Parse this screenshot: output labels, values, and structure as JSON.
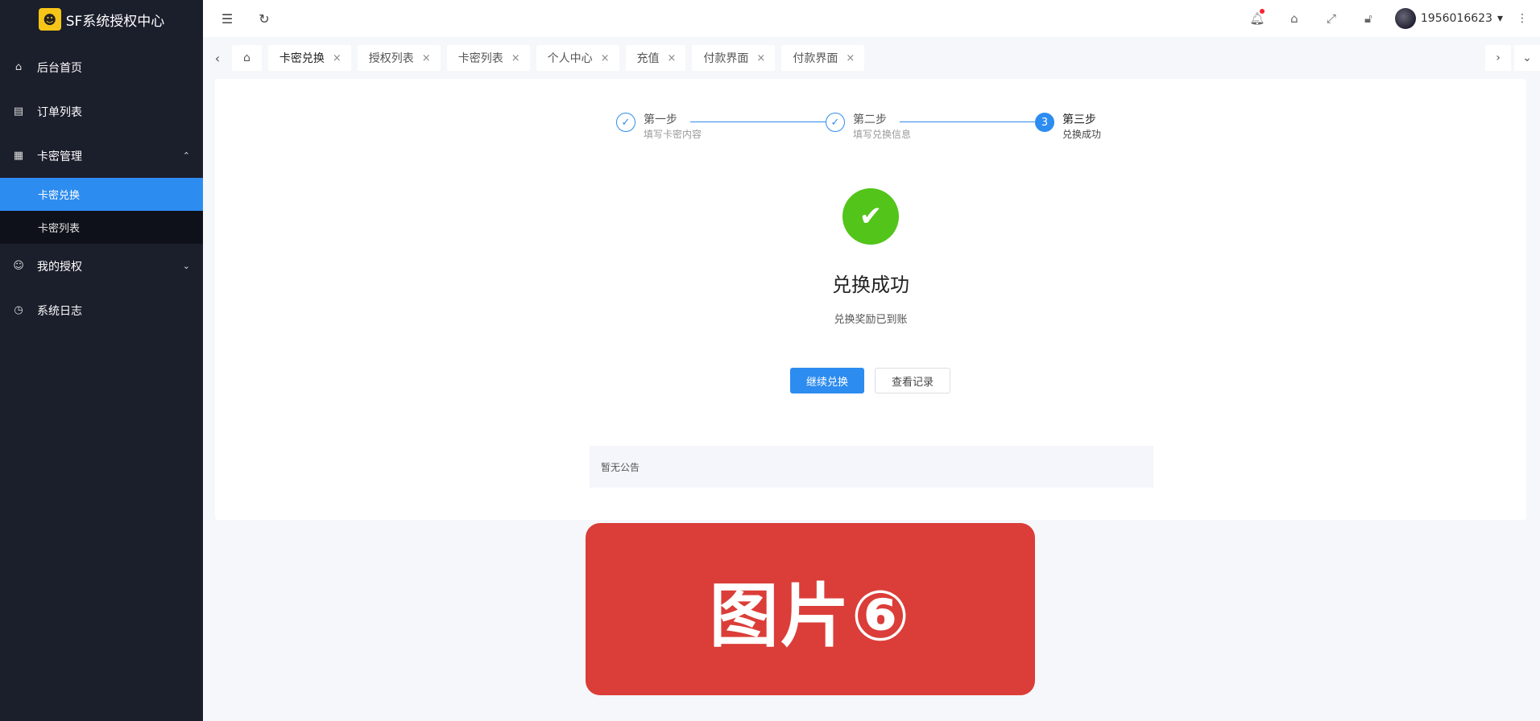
{
  "app": {
    "title": "SF系统授权中心",
    "logo_icon": "mascot-logo-icon"
  },
  "sidebar": {
    "items": [
      {
        "label": "后台首页",
        "icon": "⌂"
      },
      {
        "label": "订单列表",
        "icon": "▤"
      },
      {
        "label": "卡密管理",
        "icon": "▦",
        "expanded": true,
        "children": [
          {
            "label": "卡密兑换",
            "active": true
          },
          {
            "label": "卡密列表"
          }
        ]
      },
      {
        "label": "我的授权",
        "icon": "☺"
      },
      {
        "label": "系统日志",
        "icon": "◷"
      }
    ]
  },
  "header": {
    "user": "1956016623"
  },
  "tabs": [
    {
      "label": "卡密兑换",
      "active": true
    },
    {
      "label": "授权列表"
    },
    {
      "label": "卡密列表"
    },
    {
      "label": "个人中心"
    },
    {
      "label": "充值"
    },
    {
      "label": "付款界面"
    },
    {
      "label": "付款界面"
    }
  ],
  "steps": [
    {
      "title": "第一步",
      "desc": "填写卡密内容",
      "status": "finished"
    },
    {
      "title": "第二步",
      "desc": "填写兑换信息",
      "status": "finished"
    },
    {
      "title": "第三步",
      "desc": "兑换成功",
      "status": "current",
      "number": "3"
    }
  ],
  "result": {
    "title": "兑换成功",
    "desc": "兑换奖励已到账",
    "primary_button": "继续兑换",
    "secondary_button": "查看记录"
  },
  "notice": {
    "text": "暂无公告"
  },
  "banner": {
    "text": "图片⑥"
  },
  "colors": {
    "sidebar_bg": "#1b1e2b",
    "primary": "#2d8cf0",
    "success": "#52c41a",
    "banner": "#db3d38"
  }
}
